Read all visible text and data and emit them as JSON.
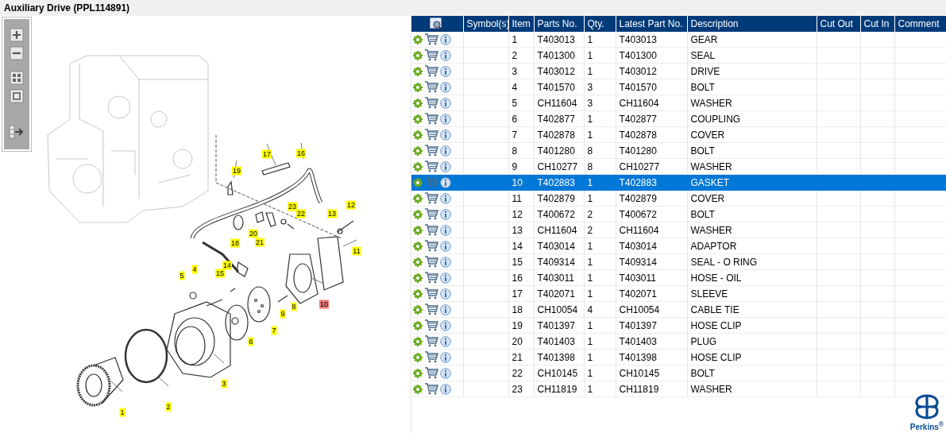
{
  "window": {
    "title": "Auxiliary Drive (PPL114891)"
  },
  "diagram": {
    "callouts": [
      {
        "label": "17",
        "selected": false
      },
      {
        "label": "16",
        "selected": false
      },
      {
        "label": "19",
        "selected": false
      },
      {
        "label": "23",
        "selected": false
      },
      {
        "label": "22",
        "selected": false
      },
      {
        "label": "12",
        "selected": false
      },
      {
        "label": "13",
        "selected": false
      },
      {
        "label": "20",
        "selected": false
      },
      {
        "label": "18",
        "selected": false
      },
      {
        "label": "21",
        "selected": false
      },
      {
        "label": "11",
        "selected": false
      },
      {
        "label": "14",
        "selected": false
      },
      {
        "label": "4",
        "selected": false
      },
      {
        "label": "15",
        "selected": false
      },
      {
        "label": "5",
        "selected": false
      },
      {
        "label": "10",
        "selected": true
      },
      {
        "label": "8",
        "selected": false
      },
      {
        "label": "9",
        "selected": false
      },
      {
        "label": "7",
        "selected": false
      },
      {
        "label": "6",
        "selected": false
      },
      {
        "label": "3",
        "selected": false
      },
      {
        "label": "2",
        "selected": false
      },
      {
        "label": "1",
        "selected": false
      }
    ]
  },
  "table": {
    "columns": [
      "Symbol(s)",
      "Item",
      "Parts No.",
      "Qty.",
      "Latest Part No.",
      "Description",
      "Cut Out",
      "Cut In",
      "Comment"
    ],
    "rows": [
      {
        "item": "1",
        "part_no": "T403013",
        "qty": "1",
        "latest": "T403013",
        "description": "GEAR",
        "selected": false
      },
      {
        "item": "2",
        "part_no": "T401300",
        "qty": "1",
        "latest": "T401300",
        "description": "SEAL",
        "selected": false
      },
      {
        "item": "3",
        "part_no": "T403012",
        "qty": "1",
        "latest": "T403012",
        "description": "DRIVE",
        "selected": false
      },
      {
        "item": "4",
        "part_no": "T401570",
        "qty": "3",
        "latest": "T401570",
        "description": "BOLT",
        "selected": false
      },
      {
        "item": "5",
        "part_no": "CH11604",
        "qty": "3",
        "latest": "CH11604",
        "description": "WASHER",
        "selected": false
      },
      {
        "item": "6",
        "part_no": "T402877",
        "qty": "1",
        "latest": "T402877",
        "description": "COUPLING",
        "selected": false
      },
      {
        "item": "7",
        "part_no": "T402878",
        "qty": "1",
        "latest": "T402878",
        "description": "COVER",
        "selected": false
      },
      {
        "item": "8",
        "part_no": "T401280",
        "qty": "8",
        "latest": "T401280",
        "description": "BOLT",
        "selected": false
      },
      {
        "item": "9",
        "part_no": "CH10277",
        "qty": "8",
        "latest": "CH10277",
        "description": "WASHER",
        "selected": false
      },
      {
        "item": "10",
        "part_no": "T402883",
        "qty": "1",
        "latest": "T402883",
        "description": "GASKET",
        "selected": true
      },
      {
        "item": "11",
        "part_no": "T402879",
        "qty": "1",
        "latest": "T402879",
        "description": "COVER",
        "selected": false
      },
      {
        "item": "12",
        "part_no": "T400672",
        "qty": "2",
        "latest": "T400672",
        "description": "BOLT",
        "selected": false
      },
      {
        "item": "13",
        "part_no": "CH11604",
        "qty": "2",
        "latest": "CH11604",
        "description": "WASHER",
        "selected": false
      },
      {
        "item": "14",
        "part_no": "T403014",
        "qty": "1",
        "latest": "T403014",
        "description": "ADAPTOR",
        "selected": false
      },
      {
        "item": "15",
        "part_no": "T409314",
        "qty": "1",
        "latest": "T409314",
        "description": "SEAL - O RING",
        "selected": false
      },
      {
        "item": "16",
        "part_no": "T403011",
        "qty": "1",
        "latest": "T403011",
        "description": "HOSE - OIL",
        "selected": false
      },
      {
        "item": "17",
        "part_no": "T402071",
        "qty": "1",
        "latest": "T402071",
        "description": "SLEEVE",
        "selected": false
      },
      {
        "item": "18",
        "part_no": "CH10054",
        "qty": "4",
        "latest": "CH10054",
        "description": "CABLE TIE",
        "selected": false
      },
      {
        "item": "19",
        "part_no": "T401397",
        "qty": "1",
        "latest": "T401397",
        "description": "HOSE CLIP",
        "selected": false
      },
      {
        "item": "20",
        "part_no": "T401403",
        "qty": "1",
        "latest": "T401403",
        "description": "PLUG",
        "selected": false
      },
      {
        "item": "21",
        "part_no": "T401398",
        "qty": "1",
        "latest": "T401398",
        "description": "HOSE CLIP",
        "selected": false
      },
      {
        "item": "22",
        "part_no": "CH10145",
        "qty": "1",
        "latest": "CH10145",
        "description": "BOLT",
        "selected": false
      },
      {
        "item": "23",
        "part_no": "CH11819",
        "qty": "1",
        "latest": "CH11819",
        "description": "WASHER",
        "selected": false
      }
    ]
  },
  "logo": {
    "text": "Perkins$^{®}$"
  }
}
